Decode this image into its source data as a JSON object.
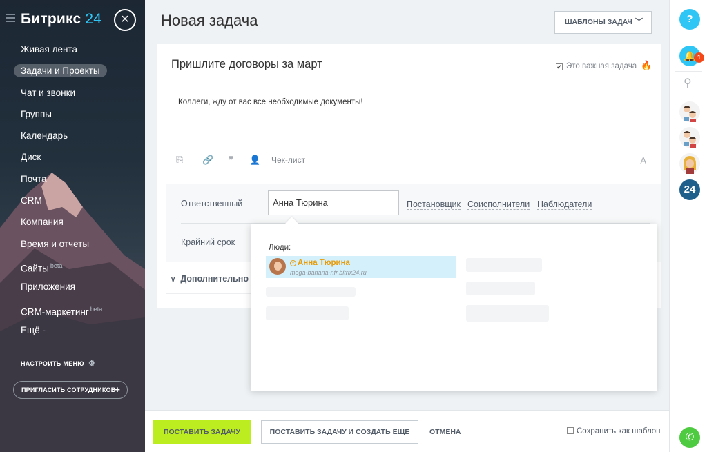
{
  "sidebar": {
    "logo_main": "Битрикс",
    "logo_num": "24",
    "close_symbol": "×",
    "items": [
      {
        "label": "Живая лента",
        "sup": ""
      },
      {
        "label": "Задачи и Проекты",
        "sup": ""
      },
      {
        "label": "Чат и звонки",
        "sup": ""
      },
      {
        "label": "Группы",
        "sup": ""
      },
      {
        "label": "Календарь",
        "sup": ""
      },
      {
        "label": "Диск",
        "sup": ""
      },
      {
        "label": "Почта",
        "sup": ""
      },
      {
        "label": "CRM",
        "sup": ""
      },
      {
        "label": "Компания",
        "sup": ""
      },
      {
        "label": "Время и отчеты",
        "sup": ""
      },
      {
        "label": "Сайты",
        "sup": "beta"
      },
      {
        "label": "Приложения",
        "sup": ""
      },
      {
        "label": "CRM-маркетинг",
        "sup": "beta"
      },
      {
        "label": "Ещё -",
        "sup": ""
      }
    ],
    "active_index": 1,
    "configure_menu": "НАСТРОИТЬ МЕНЮ",
    "invite": "ПРИГЛАСИТЬ СОТРУДНИКОВ",
    "invite_plus": "+"
  },
  "header": {
    "title": "Новая задача",
    "templates_button": "ШАБЛОНЫ ЗАДАЧ"
  },
  "task": {
    "title": "Пришлите договоры за март",
    "important_label": "Это важная задача",
    "important_checked": true,
    "description": "Коллеги, жду от вас все необходимые документы!",
    "toolbar": {
      "checklist": "Чек-лист",
      "font_label": "A"
    }
  },
  "fields": {
    "responsible_label": "Ответственный",
    "responsible_value": "Анна Тюрина",
    "roles": [
      "Постановщик",
      "Соисполнители",
      "Наблюдатели"
    ],
    "deadline_label": "Крайний срок",
    "more_label": "Дополнительно"
  },
  "popup": {
    "section_title": "Люди:",
    "person_name": "Анна Тюрина",
    "person_site": "mega-banana-nfr.bitrix24.ru"
  },
  "rightbar": {
    "help": "?",
    "notifications_badge": "1",
    "b24": "24"
  },
  "footer": {
    "submit": "ПОСТАВИТЬ ЗАДАЧУ",
    "submit_and_create": "ПОСТАВИТЬ ЗАДАЧУ И СОЗДАТЬ ЕЩЕ",
    "cancel": "ОТМЕНА",
    "save_as_template": "Сохранить как шаблон"
  },
  "colors": {
    "accent": "#2fc6f6",
    "submit_green": "#bbed21",
    "external_user": "#e89b06",
    "badge_red": "#f54819"
  }
}
